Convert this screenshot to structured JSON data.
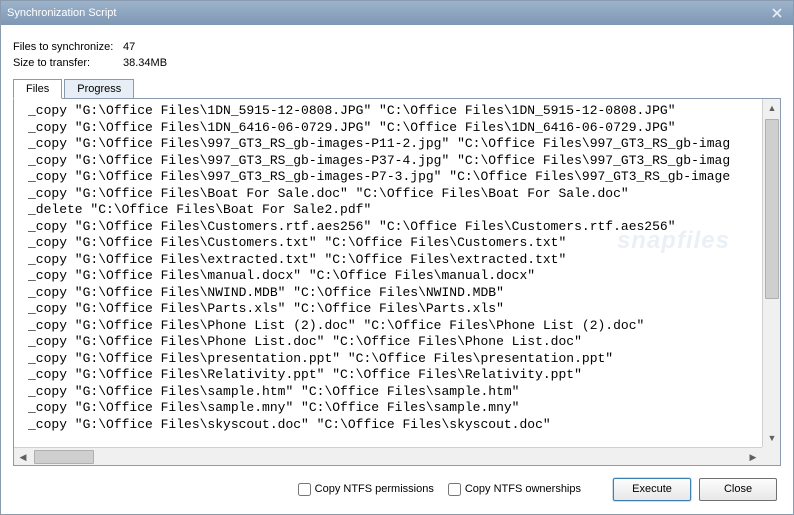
{
  "window": {
    "title": "Synchronization Script"
  },
  "stats": {
    "files_label": "Files to synchronize:",
    "files_value": "47",
    "size_label": "Size to transfer:",
    "size_value": "38.34MB"
  },
  "tabs": {
    "files": "Files",
    "progress": "Progress"
  },
  "script_lines": [
    "_copy \"G:\\Office Files\\1DN_5915-12-0808.JPG\" \"C:\\Office Files\\1DN_5915-12-0808.JPG\"",
    "_copy \"G:\\Office Files\\1DN_6416-06-0729.JPG\" \"C:\\Office Files\\1DN_6416-06-0729.JPG\"",
    "_copy \"G:\\Office Files\\997_GT3_RS_gb-images-P11-2.jpg\" \"C:\\Office Files\\997_GT3_RS_gb-imag",
    "_copy \"G:\\Office Files\\997_GT3_RS_gb-images-P37-4.jpg\" \"C:\\Office Files\\997_GT3_RS_gb-imag",
    "_copy \"G:\\Office Files\\997_GT3_RS_gb-images-P7-3.jpg\" \"C:\\Office Files\\997_GT3_RS_gb-image",
    "_copy \"G:\\Office Files\\Boat For Sale.doc\" \"C:\\Office Files\\Boat For Sale.doc\"",
    "_delete \"C:\\Office Files\\Boat For Sale2.pdf\"",
    "_copy \"G:\\Office Files\\Customers.rtf.aes256\" \"C:\\Office Files\\Customers.rtf.aes256\"",
    "_copy \"G:\\Office Files\\Customers.txt\" \"C:\\Office Files\\Customers.txt\"",
    "_copy \"G:\\Office Files\\extracted.txt\" \"C:\\Office Files\\extracted.txt\"",
    "_copy \"G:\\Office Files\\manual.docx\" \"C:\\Office Files\\manual.docx\"",
    "_copy \"G:\\Office Files\\NWIND.MDB\" \"C:\\Office Files\\NWIND.MDB\"",
    "_copy \"G:\\Office Files\\Parts.xls\" \"C:\\Office Files\\Parts.xls\"",
    "_copy \"G:\\Office Files\\Phone List (2).doc\" \"C:\\Office Files\\Phone List (2).doc\"",
    "_copy \"G:\\Office Files\\Phone List.doc\" \"C:\\Office Files\\Phone List.doc\"",
    "_copy \"G:\\Office Files\\presentation.ppt\" \"C:\\Office Files\\presentation.ppt\"",
    "_copy \"G:\\Office Files\\Relativity.ppt\" \"C:\\Office Files\\Relativity.ppt\"",
    "_copy \"G:\\Office Files\\sample.htm\" \"C:\\Office Files\\sample.htm\"",
    "_copy \"G:\\Office Files\\sample.mny\" \"C:\\Office Files\\sample.mny\"",
    "_copy \"G:\\Office Files\\skyscout.doc\" \"C:\\Office Files\\skyscout.doc\""
  ],
  "watermark": "snapfiles",
  "footer": {
    "ntfs_perms": "Copy NTFS permissions",
    "ntfs_owner": "Copy NTFS ownerships",
    "execute": "Execute",
    "close": "Close"
  }
}
